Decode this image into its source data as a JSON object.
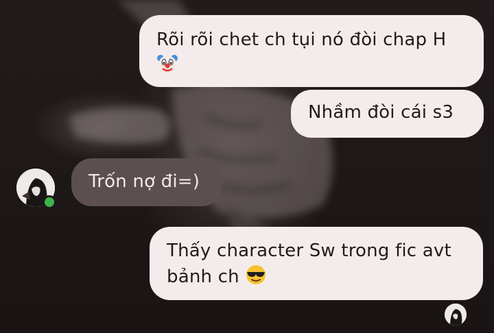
{
  "chat": {
    "messages": [
      {
        "sender": "me",
        "line1": "Rõi rõi chet ch tụi nó đòi chap H",
        "emoji": "clown-face"
      },
      {
        "sender": "me",
        "line1": "Nhầm đòi cái s3"
      },
      {
        "sender": "contact",
        "line1": "Trốn nợ đi=)"
      },
      {
        "sender": "me",
        "line1": "Thấy character Sw trong fic avt",
        "line2": "bảnh ch",
        "emoji": "smiling-face-with-sunglasses"
      }
    ],
    "contact": {
      "online": true,
      "status_color": "#38b54a"
    }
  },
  "colors": {
    "background": "#1d1717",
    "outgoing_bubble": "#f4ecec",
    "incoming_bubble": "#5c4f51"
  }
}
